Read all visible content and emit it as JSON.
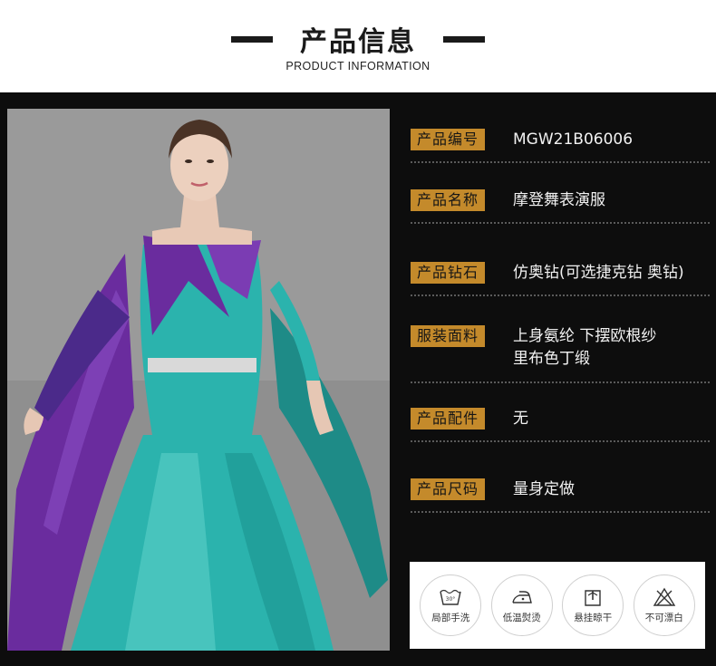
{
  "header": {
    "title": "产品信息",
    "subtitle": "PRODUCT INFORMATION"
  },
  "product": {
    "rows": [
      {
        "label": "产品编号",
        "value": "MGW21B06006"
      },
      {
        "label": "产品名称",
        "value": "摩登舞表演服"
      },
      {
        "label": "产品钻石",
        "value": "仿奥钻(可选捷克钻 奥钻)"
      },
      {
        "label": "服装面料",
        "value": "上身氨纶 下摆欧根纱",
        "value2": "里布色丁缎"
      },
      {
        "label": "产品配件",
        "value": "无"
      },
      {
        "label": "产品尺码",
        "value": "量身定做"
      }
    ]
  },
  "care": {
    "items": [
      {
        "label": "局部手洗",
        "icon": "hand-wash-icon"
      },
      {
        "label": "低温熨烫",
        "icon": "iron-low-icon"
      },
      {
        "label": "悬挂晾干",
        "icon": "hang-dry-icon"
      },
      {
        "label": "不可漂白",
        "icon": "no-bleach-icon"
      }
    ]
  },
  "colors": {
    "label_bg": "#c48a2b",
    "panel_bg": "#0d0d0d",
    "dress_teal": "#2bb3ad",
    "dress_purple": "#6a2c9e"
  }
}
